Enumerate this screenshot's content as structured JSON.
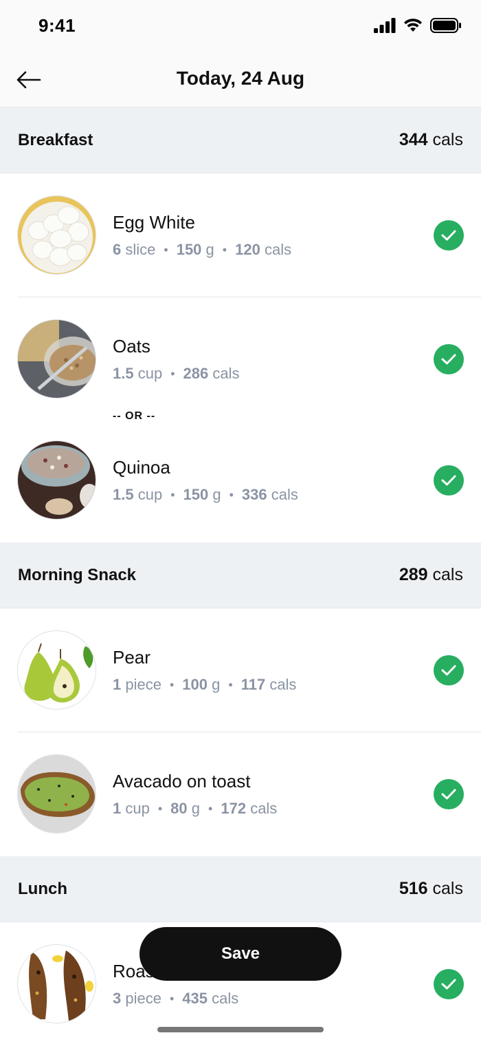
{
  "status": {
    "time": "9:41"
  },
  "header": {
    "title": "Today, 24 Aug"
  },
  "sections": [
    {
      "title": "Breakfast",
      "cals_value": "344",
      "cals_unit": "cals",
      "items": [
        {
          "name": "Egg White",
          "qty_num": "6",
          "qty_unit": "slice",
          "weight_num": "150",
          "weight_unit": "g",
          "cals_num": "120",
          "cals_unit": "cals"
        },
        {
          "name": "Oats",
          "qty_num": "1.5",
          "qty_unit": "cup",
          "cals_num": "286",
          "cals_unit": "cals"
        },
        {
          "name": "Quinoa",
          "qty_num": "1.5",
          "qty_unit": "cup",
          "weight_num": "150",
          "weight_unit": "g",
          "cals_num": "336",
          "cals_unit": "cals"
        }
      ],
      "or_label": "-- OR --"
    },
    {
      "title": "Morning Snack",
      "cals_value": "289",
      "cals_unit": "cals",
      "items": [
        {
          "name": "Pear",
          "qty_num": "1",
          "qty_unit": "piece",
          "weight_num": "100",
          "weight_unit": "g",
          "cals_num": "117",
          "cals_unit": "cals"
        },
        {
          "name": "Avacado on toast",
          "qty_num": "1",
          "qty_unit": "cup",
          "weight_num": "80",
          "weight_unit": "g",
          "cals_num": "172",
          "cals_unit": "cals"
        }
      ]
    },
    {
      "title": "Lunch",
      "cals_value": "516",
      "cals_unit": "cals",
      "items": [
        {
          "name": "Roasted Fish",
          "qty_num": "3",
          "qty_unit": "piece",
          "cals_num": "435",
          "cals_unit": "cals"
        }
      ]
    }
  ],
  "actions": {
    "save_label": "Save"
  },
  "colors": {
    "accent_check": "#27ae60",
    "section_bg": "#eef1f4",
    "meta_text": "#8a93a3",
    "save_bg": "#111111"
  },
  "icons": {
    "back": "arrow-left-icon",
    "check": "check-circle-icon",
    "signal": "cellular-signal-icon",
    "wifi": "wifi-icon",
    "battery": "battery-icon"
  }
}
